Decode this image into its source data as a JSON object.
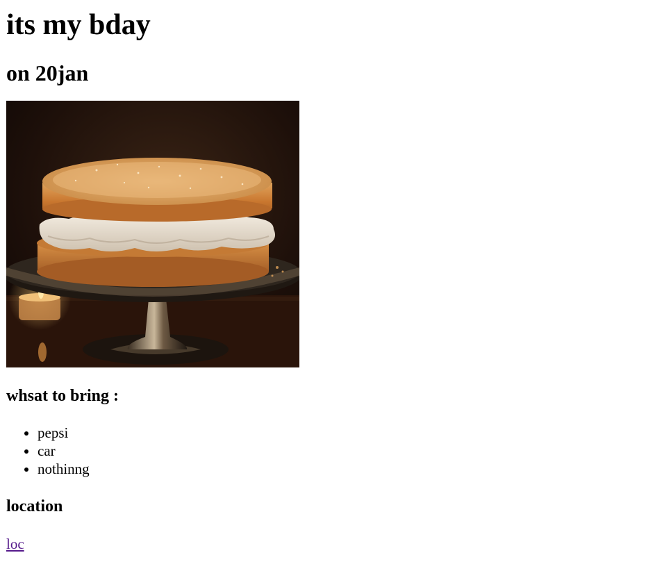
{
  "page": {
    "title": "its my bday",
    "date": "on 20jan"
  },
  "image": {
    "icon": "cake-photo",
    "colors": {
      "background": "#1a0d08",
      "sponge": "#c9772f",
      "cream": "#e8ddcf",
      "stand": "#2e261e"
    }
  },
  "bring": {
    "heading": "whsat to bring :",
    "items": [
      "pepsi",
      "car",
      "nothinng"
    ]
  },
  "location": {
    "heading": "location",
    "link_label": "loc"
  }
}
